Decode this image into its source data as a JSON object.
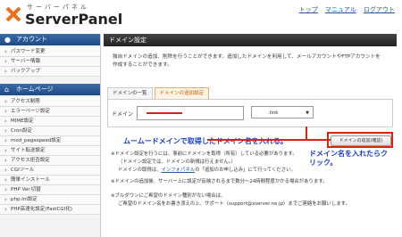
{
  "header": {
    "logo_sub": "サーバーパネル",
    "logo_main": "ServerPanel",
    "links": [
      "トップ",
      "マニュアル",
      "ログアウト"
    ]
  },
  "sidebar": {
    "account_title": "アカウント",
    "account_items": [
      "パスワード変更",
      "サーバー情報",
      "バックアップ"
    ],
    "homepage_title": "ホームページ",
    "homepage_items": [
      "アクセス制限",
      "エラーページ設定",
      "MIME設定",
      "Cron設定",
      "mod_pagespeed設定",
      "サイト転送設定",
      "アクセス拒否設定",
      "CGIツール",
      "簡単インストール",
      "PHP Ver.切替",
      "php.ini設定",
      "PHP高速化設定(FastCGI化)"
    ]
  },
  "main": {
    "title": "ドメイン設定",
    "desc1": "独自ドメインの追加、削除を行うことができます。追加したドメインを利用して、メールアカウントやFTPアカウントを",
    "desc2": "作成することができます。",
    "tabs": [
      "ドメインの一覧",
      "ドメインの追加設定"
    ],
    "domain_label": "ドメイン",
    "tld_value": ".link",
    "add_button": "ドメインの追加(確認)",
    "annotation_1": "ムームードメインで取得したドメイン名を入れる。",
    "annotation_2": "ドメイン名を入れたらクリック。",
    "note1": "※ドメイン設定を行うには、事前にドメインを取得（所有）している必要があります。",
    "note2": "（ドメイン設定では、ドメインの新規は行えません。）",
    "note3_a": "ドメインの取得は、",
    "note3_link": "インフォパネル",
    "note3_b": "の「追加のお申し込み」にて行ってください。",
    "note4": "※ドメインの追加後、サーバー上に設定が反映されるまで数分～24時間程度かかる場合があります。",
    "note5": "※ブルダウンにご希望のドメイン種別がない場合は、",
    "note6": "ご希望のドメイン名をお書き添えの上、サポート（support@xserver.ne.jp）までご連絡をお願いします。"
  }
}
